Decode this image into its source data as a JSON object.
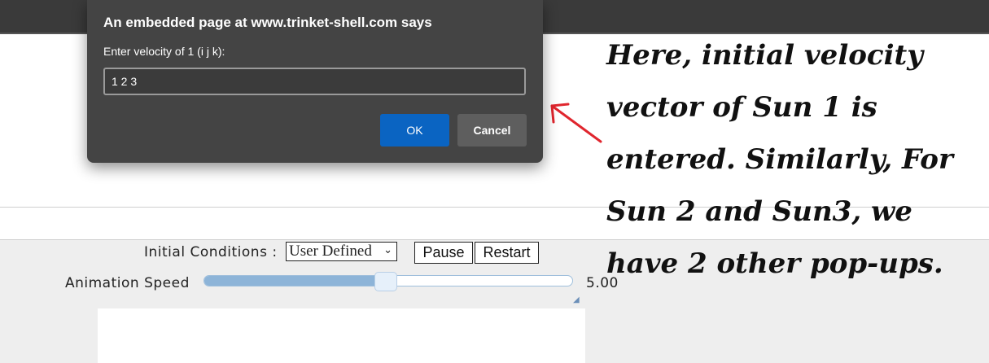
{
  "dialog": {
    "title": "An embedded page at www.trinket-shell.com says",
    "message": "Enter velocity of 1 (i j k):",
    "input_value": "1 2 3",
    "ok_label": "OK",
    "cancel_label": "Cancel"
  },
  "controls": {
    "initial_conditions_label": "Initial Conditions :",
    "initial_conditions_selected": "User Defined",
    "pause_label": "Pause",
    "restart_label": "Restart",
    "animation_speed_label": "Animation Speed",
    "animation_speed_value": "5.00",
    "slider_fraction": 0.48
  },
  "annotation": {
    "lines": [
      "Here, initial velocity",
      "vector of Sun 1 is",
      "entered. Similarly, For",
      "Sun 2 and Sun3,  we",
      "have 2 other pop-ups."
    ]
  },
  "icons": {
    "select_chevron": "chevron-down-icon",
    "arrow": "red-arrow-icon",
    "resize": "resize-grip-icon"
  },
  "colors": {
    "dialog_bg": "#444444",
    "ok_button": "#0a64c2",
    "arrow": "#e0262e",
    "slider_fill": "#8db4d8"
  }
}
